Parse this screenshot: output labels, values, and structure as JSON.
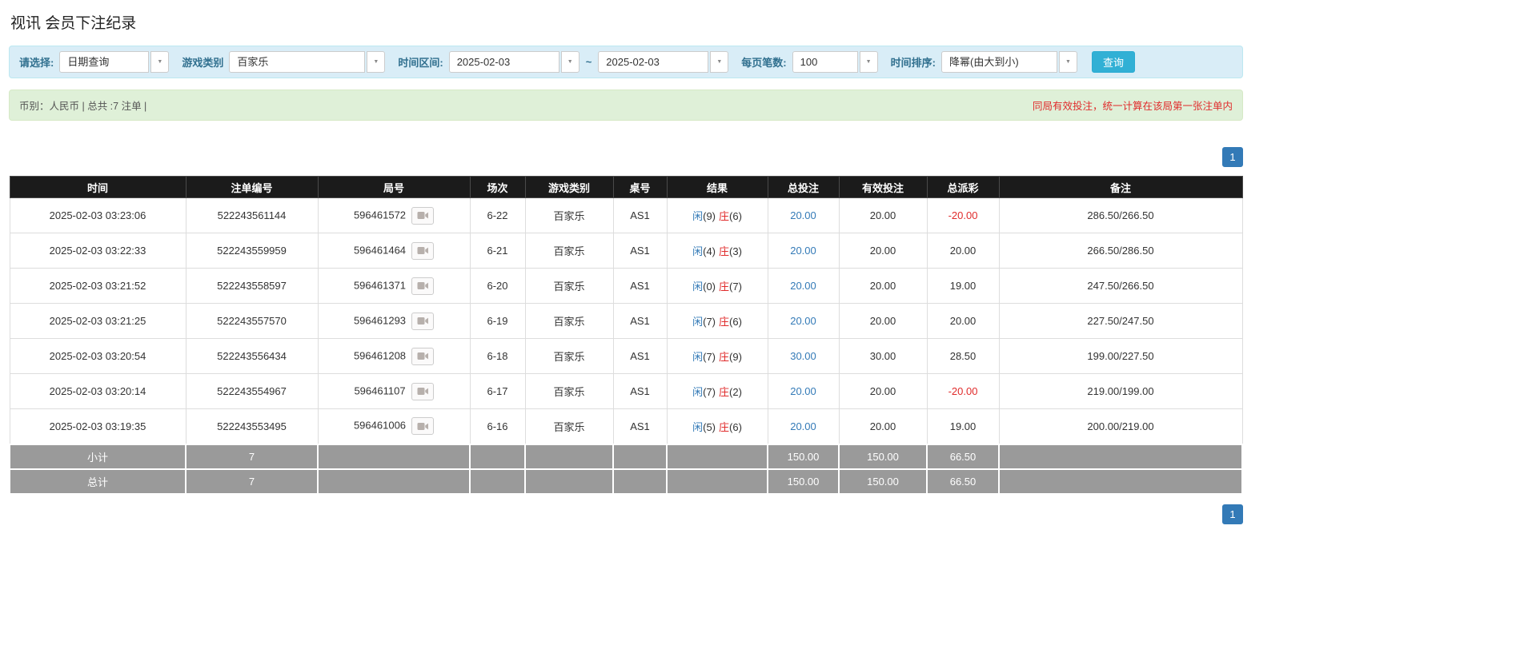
{
  "page": {
    "title": "视讯 会员下注纪录"
  },
  "colors": {
    "accent_blue": "#337ab7",
    "search_button_blue": "#31b0d5",
    "danger_red": "#e02b2b",
    "filter_bar_bg": "#d9edf7",
    "summary_bar_bg": "#dff0d8",
    "table_header_bg": "#1b1b1b",
    "table_footer_bg": "#9a9a9a"
  },
  "icons": {
    "caret": "▼"
  },
  "filters": {
    "select_label": "请选择:",
    "select_value": "日期查询",
    "game_type_label": "游戏类别",
    "game_type_value": "百家乐",
    "date_range_label": "时间区间:",
    "date_from": "2025-02-03",
    "date_separator": "~",
    "date_to": "2025-02-03",
    "page_size_label": "每页笔数:",
    "page_size_value": "100",
    "sort_label": "时间排序:",
    "sort_value": "降幂(由大到小)",
    "search_button_label": "查询"
  },
  "summary": {
    "left_text": "币别：人民币 | 总共 :7 注单 |",
    "right_note": "同局有效投注，统一计算在该局第一张注单内"
  },
  "pagination": {
    "current_page": "1"
  },
  "table": {
    "headers": [
      "时间",
      "注单编号",
      "局号",
      "场次",
      "游戏类别",
      "桌号",
      "结果",
      "总投注",
      "有效投注",
      "总派彩",
      "备注"
    ],
    "rows": [
      {
        "time": "2025-02-03 03:23:06",
        "bet_id": "522243561144",
        "round_id": "596461572",
        "session": "6-22",
        "game": "百家乐",
        "table_no": "AS1",
        "player_name": "闲",
        "player_value": "(9)",
        "banker_name": "庄",
        "banker_value": "(6)",
        "total_bet": "20.00",
        "valid_bet": "20.00",
        "payout": "-20.00",
        "remark": "286.50/266.50"
      },
      {
        "time": "2025-02-03 03:22:33",
        "bet_id": "522243559959",
        "round_id": "596461464",
        "session": "6-21",
        "game": "百家乐",
        "table_no": "AS1",
        "player_name": "闲",
        "player_value": "(4)",
        "banker_name": "庄",
        "banker_value": "(3)",
        "total_bet": "20.00",
        "valid_bet": "20.00",
        "payout": "20.00",
        "remark": "266.50/286.50"
      },
      {
        "time": "2025-02-03 03:21:52",
        "bet_id": "522243558597",
        "round_id": "596461371",
        "session": "6-20",
        "game": "百家乐",
        "table_no": "AS1",
        "player_name": "闲",
        "player_value": "(0)",
        "banker_name": "庄",
        "banker_value": "(7)",
        "total_bet": "20.00",
        "valid_bet": "20.00",
        "payout": "19.00",
        "remark": "247.50/266.50"
      },
      {
        "time": "2025-02-03 03:21:25",
        "bet_id": "522243557570",
        "round_id": "596461293",
        "session": "6-19",
        "game": "百家乐",
        "table_no": "AS1",
        "player_name": "闲",
        "player_value": "(7)",
        "banker_name": "庄",
        "banker_value": "(6)",
        "total_bet": "20.00",
        "valid_bet": "20.00",
        "payout": "20.00",
        "remark": "227.50/247.50"
      },
      {
        "time": "2025-02-03 03:20:54",
        "bet_id": "522243556434",
        "round_id": "596461208",
        "session": "6-18",
        "game": "百家乐",
        "table_no": "AS1",
        "player_name": "闲",
        "player_value": "(7)",
        "banker_name": "庄",
        "banker_value": "(9)",
        "total_bet": "30.00",
        "valid_bet": "30.00",
        "payout": "28.50",
        "remark": "199.00/227.50"
      },
      {
        "time": "2025-02-03 03:20:14",
        "bet_id": "522243554967",
        "round_id": "596461107",
        "session": "6-17",
        "game": "百家乐",
        "table_no": "AS1",
        "player_name": "闲",
        "player_value": "(7)",
        "banker_name": "庄",
        "banker_value": "(2)",
        "total_bet": "20.00",
        "valid_bet": "20.00",
        "payout": "-20.00",
        "remark": "219.00/199.00"
      },
      {
        "time": "2025-02-03 03:19:35",
        "bet_id": "522243553495",
        "round_id": "596461006",
        "session": "6-16",
        "game": "百家乐",
        "table_no": "AS1",
        "player_name": "闲",
        "player_value": "(5)",
        "banker_name": "庄",
        "banker_value": "(6)",
        "total_bet": "20.00",
        "valid_bet": "20.00",
        "payout": "19.00",
        "remark": "200.00/219.00"
      }
    ],
    "subtotal": {
      "label": "小计",
      "count": "7",
      "total_bet": "150.00",
      "valid_bet": "150.00",
      "payout": "66.50"
    },
    "grand_total": {
      "label": "总计",
      "count": "7",
      "total_bet": "150.00",
      "valid_bet": "150.00",
      "payout": "66.50"
    }
  }
}
